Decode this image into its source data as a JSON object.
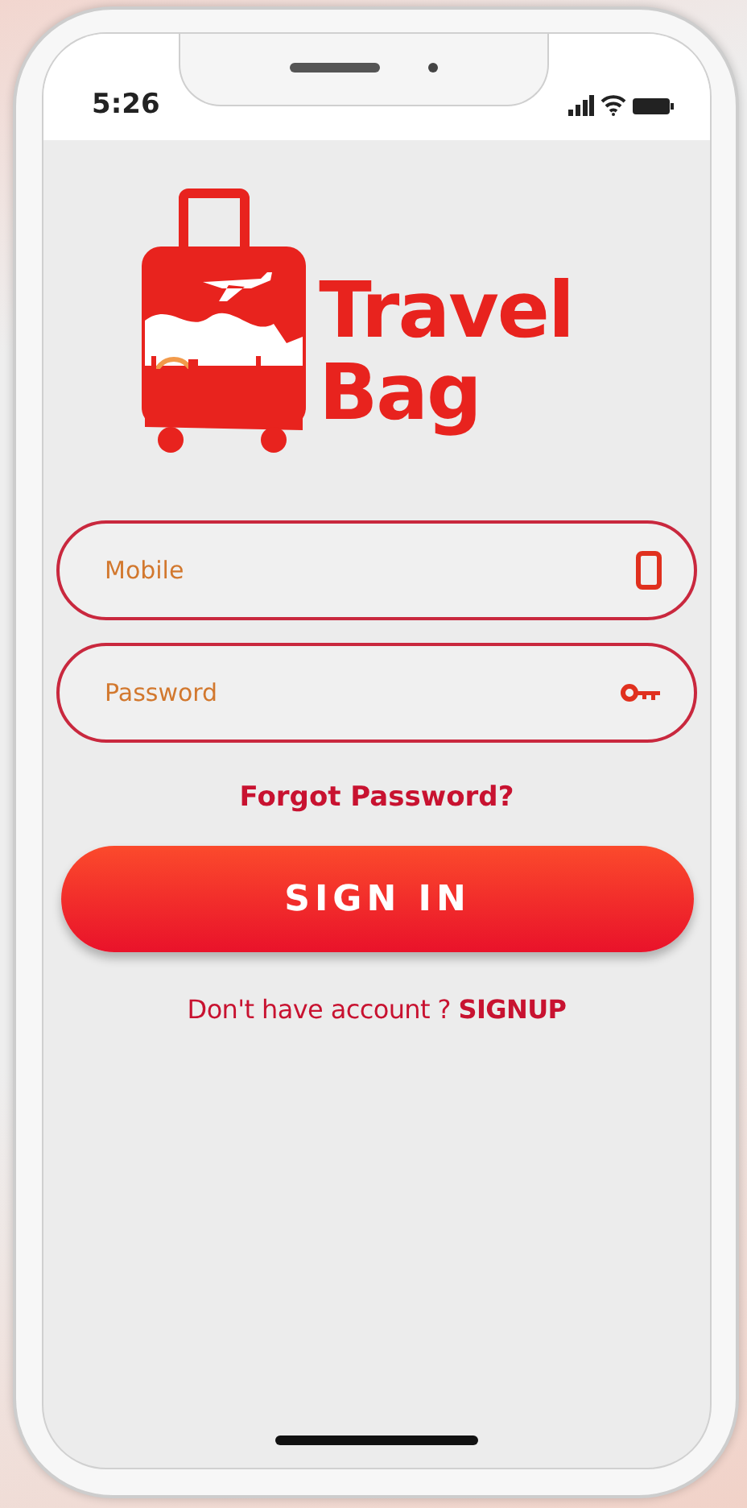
{
  "status_bar": {
    "time": "5:26"
  },
  "logo": {
    "line_1": "Travel",
    "line_2": "Bag"
  },
  "fields": [
    {
      "kind": "phone",
      "placeholder": "Mobile"
    },
    {
      "kind": "password",
      "placeholder": "Password"
    }
  ],
  "forgot_link": "Forgot Password?",
  "sign_in_button": "SIGN IN",
  "signup_prompt": {
    "text": "Don't have account ?",
    "link": "SIGNUP"
  }
}
